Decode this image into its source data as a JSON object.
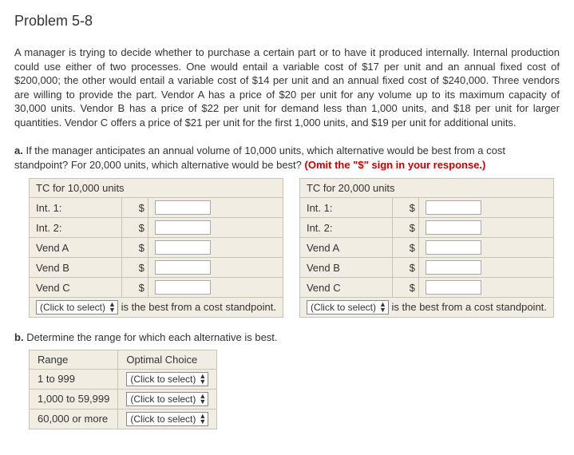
{
  "title": "Problem 5-8",
  "intro": "A manager is trying to decide whether to purchase a certain part or to have it produced internally. Internal production could use either of two processes. One would entail a variable cost of $17 per unit and an annual fixed cost of $200,000; the other would entail a variable cost of $14 per unit and an annual fixed cost of $240,000. Three vendors are willing to provide the part. Vendor A has a  price of $20 per unit for any volume up to its maximum capacity of 30,000 units. Vendor B has a price of $22 per unit for demand less than 1,000 units, and $18 per unit for larger quantities. Vendor C offers a price of $21 per unit for the first 1,000 units, and $19 per unit for additional units.",
  "partA": {
    "label": "a.",
    "text": "If the manager anticipates an annual volume of 10,000 units, which alternative would be best from a cost standpoint? For 20,000 units, which alternative would be best? ",
    "omit": "(Omit the \"$\" sign in your response.)",
    "table1Header": "TC for 10,000 units",
    "table2Header": "TC for 20,000 units",
    "rows": [
      "Int. 1:",
      "Int. 2:",
      "Vend A",
      "Vend B",
      "Vend C"
    ],
    "dollar": "$",
    "selectPlaceholder": "(Click to select)",
    "bestText": " is the best from a cost standpoint."
  },
  "partB": {
    "label": "b.",
    "text": "Determine the range for which each alternative is best.",
    "headers": [
      "Range",
      "Optimal Choice"
    ],
    "ranges": [
      "1 to 999",
      "1,000 to 59,999",
      "60,000 or more"
    ],
    "selectPlaceholder": "(Click to select)"
  }
}
